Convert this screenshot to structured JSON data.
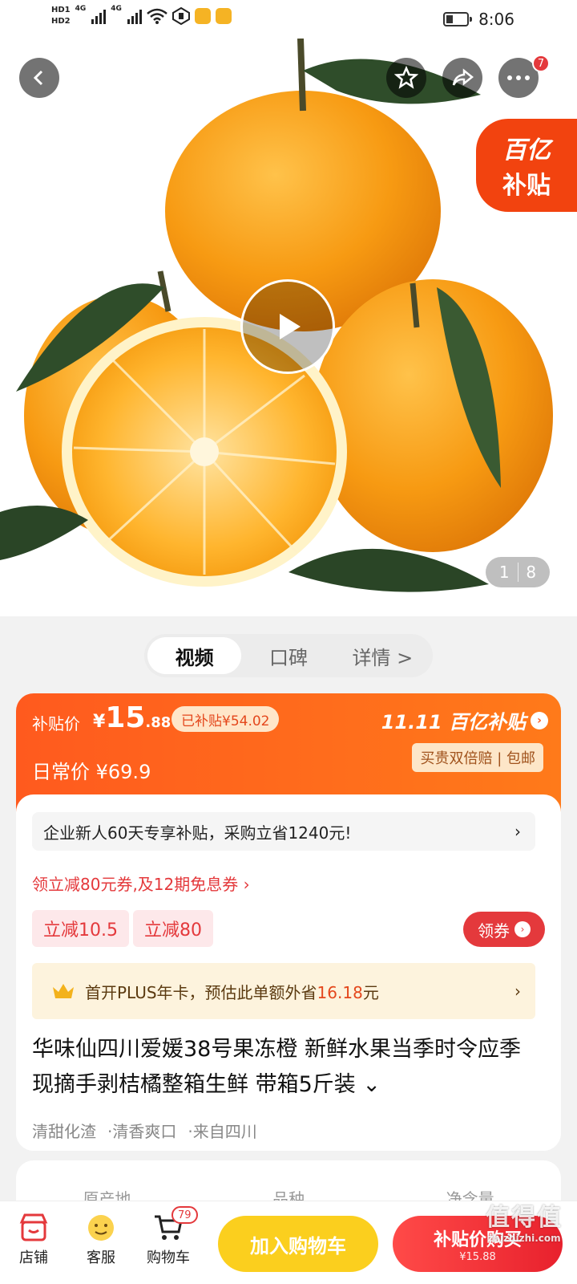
{
  "status_bar": {
    "hd1": "HD1",
    "hd2": "HD2",
    "net1": "4G",
    "net2": "4G",
    "time": "8:06"
  },
  "hero": {
    "more_badge": "7",
    "subsidy_tag_line1": "百亿",
    "subsidy_tag_line2": "补贴",
    "pager_current": "1",
    "pager_total": "8"
  },
  "tabs": [
    {
      "label": "视频"
    },
    {
      "label": "口碑"
    },
    {
      "label": "详情 >"
    }
  ],
  "price": {
    "subsidy_label": "补贴价",
    "currency": "¥",
    "price_int": "15",
    "price_dec": ".88",
    "already_subsidized": "已补贴¥54.02",
    "normal_price": "日常价 ¥69.9",
    "brand": "11.11 百亿补贴",
    "guarantee": "买贵双倍赔 | 包邮"
  },
  "promo": {
    "enterprise_text": "企业新人60天专享补贴，采购立省1240元!",
    "coupon_line": "领立减80元券,及12期免息券 ›",
    "pill1": "立减10.5",
    "pill2": "立减80",
    "get_coupon": "领券",
    "plus_text_a": "首开PLUS年卡，预估此单额外省",
    "plus_highlight": "16.18",
    "plus_text_b": "元"
  },
  "product": {
    "title": "华味仙四川爱媛38号果冻橙 新鲜水果当季时令应季现摘手剥桔橘整箱生鲜 带箱5斤装 ⌄",
    "tags": [
      "清甜化渣",
      "·清香爽口",
      "·来自四川"
    ]
  },
  "specs": [
    "原产地",
    "品种",
    "净含量"
  ],
  "bottom_bar": {
    "shop": "店铺",
    "service": "客服",
    "cart": "购物车",
    "cart_count": "79",
    "add_to_cart": "加入购物车",
    "buy_line1": "补贴价购买",
    "buy_line2": "¥15.88"
  },
  "watermark": {
    "line1": "值得值",
    "line2": "zhizhizhi.com"
  }
}
